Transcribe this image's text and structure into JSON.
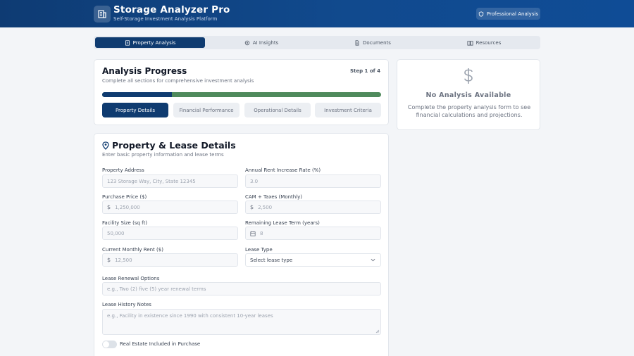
{
  "header": {
    "title": "Storage Analyzer Pro",
    "subtitle": "Self-Storage Investment Analysis Platform",
    "pro_button": "Professional Analysis",
    "logo_icon": "building-icon"
  },
  "tabs": [
    {
      "label": "Property Analysis",
      "icon": "document-icon",
      "active": true
    },
    {
      "label": "AI Insights",
      "icon": "brain-icon",
      "active": false
    },
    {
      "label": "Documents",
      "icon": "file-icon",
      "active": false
    },
    {
      "label": "Resources",
      "icon": "book-icon",
      "active": false
    }
  ],
  "progress": {
    "title": "Analysis Progress",
    "subtitle": "Complete all sections for comprehensive investment analysis",
    "step": "Step 1 of 4",
    "fraction": 0.25,
    "colors": {
      "filled": "#0f3b70",
      "remaining": "#4f8a5c"
    },
    "steps": [
      "Property Details",
      "Financial Performance",
      "Operational Details",
      "Investment Criteria"
    ]
  },
  "side": {
    "icon": "dollar-icon",
    "title": "No Analysis Available",
    "text": "Complete the property analysis form to see financial calculations and projections."
  },
  "form": {
    "title": "Property & Lease Details",
    "subtitle": "Enter basic property information and lease terms",
    "address_label": "Property Address",
    "address_placeholder": "123 Storage Way, City, State 12345",
    "rent_increase_label": "Annual Rent Increase Rate (%)",
    "rent_increase_placeholder": "3.0",
    "price_label": "Purchase Price ($)",
    "price_placeholder": "1,250,000",
    "cam_label": "CAM + Taxes (Monthly)",
    "cam_placeholder": "2,500",
    "size_label": "Facility Size (sq ft)",
    "size_placeholder": "50,000",
    "lease_term_label": "Remaining Lease Term (years)",
    "lease_term_placeholder": "8",
    "monthly_rent_label": "Current Monthly Rent ($)",
    "monthly_rent_placeholder": "12,500",
    "lease_type_label": "Lease Type",
    "lease_type_value": "Select lease type",
    "renewal_label": "Lease Renewal Options",
    "renewal_placeholder": "e.g., Two (2) five (5) year renewal terms",
    "history_label": "Lease History Notes",
    "history_placeholder": "e.g., Facility in existence since 1990 with consistent 10-year leases",
    "real_estate_label": "Real Estate Included in Purchase",
    "currency_symbol": "$"
  }
}
